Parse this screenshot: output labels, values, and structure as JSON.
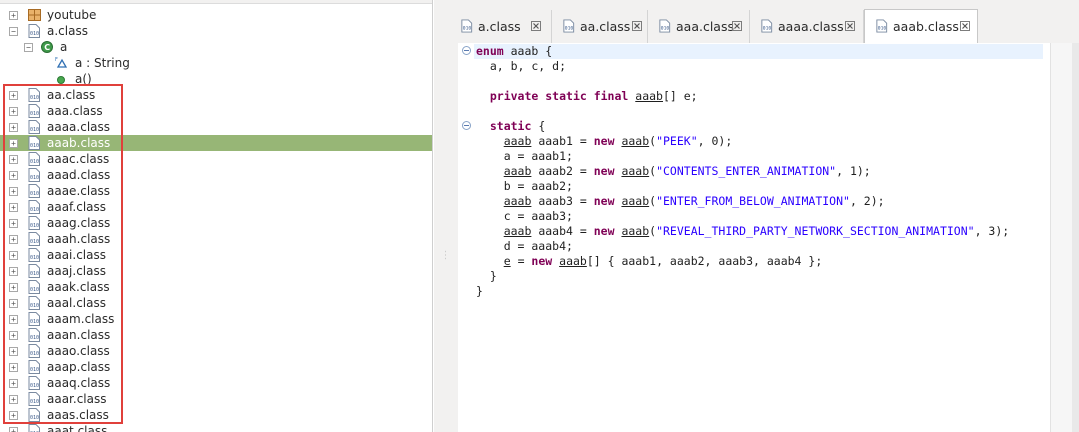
{
  "tree": {
    "items": [
      {
        "label": "youtube",
        "kind": "package",
        "expander": "+"
      },
      {
        "label": "a.class",
        "kind": "classfile",
        "expander": "−"
      },
      {
        "label": "a",
        "kind": "class-element",
        "expander": "−"
      },
      {
        "label": "a : String",
        "kind": "field"
      },
      {
        "label": "a()",
        "kind": "method"
      },
      {
        "label": "aa.class",
        "kind": "classfile",
        "expander": "+"
      },
      {
        "label": "aaa.class",
        "kind": "classfile",
        "expander": "+"
      },
      {
        "label": "aaaa.class",
        "kind": "classfile",
        "expander": "+"
      },
      {
        "label": "aaab.class",
        "kind": "classfile",
        "expander": "+",
        "selected": true
      },
      {
        "label": "aaac.class",
        "kind": "classfile",
        "expander": "+"
      },
      {
        "label": "aaad.class",
        "kind": "classfile",
        "expander": "+"
      },
      {
        "label": "aaae.class",
        "kind": "classfile",
        "expander": "+"
      },
      {
        "label": "aaaf.class",
        "kind": "classfile",
        "expander": "+"
      },
      {
        "label": "aaag.class",
        "kind": "classfile",
        "expander": "+"
      },
      {
        "label": "aaah.class",
        "kind": "classfile",
        "expander": "+"
      },
      {
        "label": "aaai.class",
        "kind": "classfile",
        "expander": "+"
      },
      {
        "label": "aaaj.class",
        "kind": "classfile",
        "expander": "+"
      },
      {
        "label": "aaak.class",
        "kind": "classfile",
        "expander": "+"
      },
      {
        "label": "aaal.class",
        "kind": "classfile",
        "expander": "+"
      },
      {
        "label": "aaam.class",
        "kind": "classfile",
        "expander": "+"
      },
      {
        "label": "aaan.class",
        "kind": "classfile",
        "expander": "+"
      },
      {
        "label": "aaao.class",
        "kind": "classfile",
        "expander": "+"
      },
      {
        "label": "aaap.class",
        "kind": "classfile",
        "expander": "+"
      },
      {
        "label": "aaaq.class",
        "kind": "classfile",
        "expander": "+"
      },
      {
        "label": "aaar.class",
        "kind": "classfile",
        "expander": "+"
      },
      {
        "label": "aaas.class",
        "kind": "classfile",
        "expander": "+"
      },
      {
        "label": "aaat.class",
        "kind": "classfile",
        "expander": "+"
      }
    ],
    "selection_color": "#97b676",
    "highlight_color": "#e0403b"
  },
  "tabs": [
    {
      "label": "a.class"
    },
    {
      "label": "aa.class"
    },
    {
      "label": "aaa.class"
    },
    {
      "label": "aaaa.class"
    },
    {
      "label": "aaab.class",
      "active": true
    }
  ],
  "editor": {
    "keyword_color": "#7f0055",
    "string_color": "#2a00ff",
    "line1": {
      "kw": "enum",
      "rest": " aaab {"
    },
    "line2": "  a, b, c, d;",
    "line4": {
      "kw": "private static final",
      "type": "aaab",
      "rest": "[] e;"
    },
    "line6": {
      "kw": "static",
      "rest": " {"
    },
    "line7": {
      "type": "aaab",
      "mid": " aaab1 = ",
      "kw": "new",
      "type2": "aaab",
      "open": "(",
      "str": "\"PEEK\"",
      "rest": ", 0);"
    },
    "line8": "    a = aaab1;",
    "line9": {
      "type": "aaab",
      "mid": " aaab2 = ",
      "kw": "new",
      "type2": "aaab",
      "open": "(",
      "str": "\"CONTENTS_ENTER_ANIMATION\"",
      "rest": ", 1);"
    },
    "line10": "    b = aaab2;",
    "line11": {
      "type": "aaab",
      "mid": " aaab3 = ",
      "kw": "new",
      "type2": "aaab",
      "open": "(",
      "str": "\"ENTER_FROM_BELOW_ANIMATION\"",
      "rest": ", 2);"
    },
    "line12": "    c = aaab3;",
    "line13": {
      "type": "aaab",
      "mid": " aaab4 = ",
      "kw": "new",
      "type2": "aaab",
      "open": "(",
      "str": "\"REVEAL_THIRD_PARTY_NETWORK_SECTION_ANIMATION\"",
      "rest": ", 3);"
    },
    "line14": "    d = aaab4;",
    "line15": {
      "type": "e",
      "mid": " = ",
      "kw": "new",
      "type2": "aaab",
      "rest": "[] { aaab1, aaab2, aaab3, aaab4 };"
    },
    "line16": "  }",
    "line17": "}"
  }
}
